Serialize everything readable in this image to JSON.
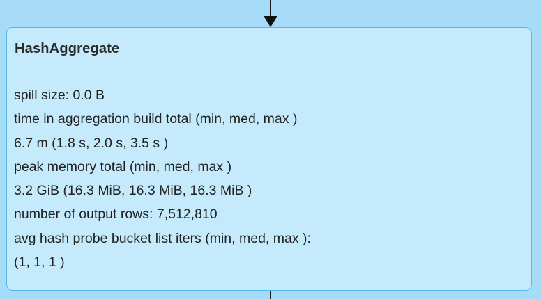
{
  "node": {
    "title": "HashAggregate",
    "metrics": [
      "spill size: 0.0 B",
      "time in aggregation build total (min, med, max )",
      "6.7 m (1.8 s, 2.0 s, 3.5 s )",
      "peak memory total (min, med, max )",
      "3.2 GiB (16.3 MiB, 16.3 MiB, 16.3 MiB )",
      "number of output rows: 7,512,810",
      "avg hash probe bucket list iters (min, med, max ):",
      "(1, 1, 1 )"
    ]
  },
  "colors": {
    "background": "#a6dcf7",
    "node_fill": "#c4eafb",
    "node_border": "#55b7ea",
    "edge": "#1a1a1a"
  }
}
